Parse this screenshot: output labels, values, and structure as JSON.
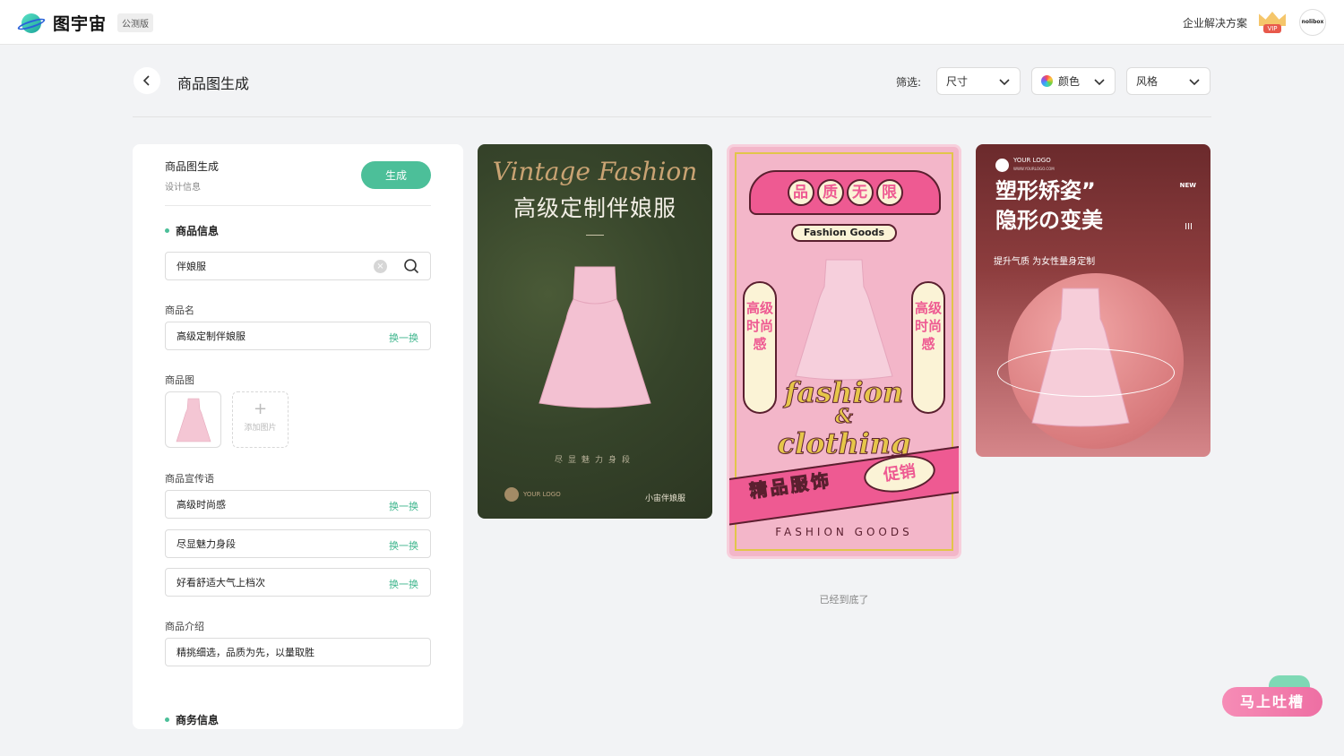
{
  "app": {
    "name": "图宇宙",
    "badge": "公测版",
    "enterprise_link": "企业解决方案",
    "vip_label": "VIP",
    "avatar_text": "nolibox"
  },
  "header": {
    "title": "商品图生成",
    "filter_label": "筛选:",
    "filters": [
      {
        "label": "尺寸"
      },
      {
        "label": "颜色"
      },
      {
        "label": "风格"
      }
    ]
  },
  "panel": {
    "title": "商品图生成",
    "subtitle": "设计信息",
    "generate_label": "生成",
    "product_section": "商品信息",
    "search_value": "伴娘服",
    "name_label": "商品名",
    "name_value": "高级定制伴娘服",
    "swap_label": "换一换",
    "image_label": "商品图",
    "add_image_label": "添加图片",
    "slogan_label": "商品宣传语",
    "slogans": [
      "高级时尚感",
      "尽显魅力身段",
      "好看舒适大气上档次"
    ],
    "intro_label": "商品介绍",
    "intro_value": "精挑细选，品质为先，以量取胜",
    "business_section": "商务信息"
  },
  "cards": {
    "c1": {
      "script": "Vintage Fashion",
      "title": "高级定制伴娘服",
      "slogan": "尽显魅力身段",
      "logo": "YOUR LOGO",
      "shop": "小宙伴娘服"
    },
    "c2": {
      "banner": [
        "品",
        "质",
        "无",
        "限"
      ],
      "pill": "Fashion Goods",
      "vert_left": "高级时尚感",
      "vert_right": "高级时尚感",
      "script1": "fashion",
      "script_amp": "&",
      "script2": "clothing",
      "promo1": "精品服饰",
      "promo2": "促销",
      "footer": "FASHION GOODS"
    },
    "c3": {
      "logo": "YOUR LOGO",
      "logo_url": "WWW.YOURLOGO.COM",
      "new_label": "NEW",
      "bars": "III",
      "title_line1": "塑形矫姿”",
      "title_line2": "隐形の变美",
      "subtitle": "提升气质 为女性量身定制"
    }
  },
  "end_text": "已经到底了",
  "feedback_label": "马上吐槽",
  "colors": {
    "accent": "#4cbf99",
    "brand_pink": "#ee5a92",
    "background": "#f2f3f5"
  }
}
